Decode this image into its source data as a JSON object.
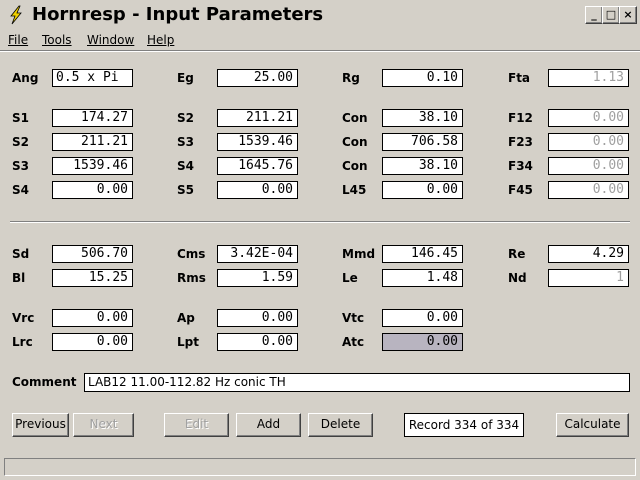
{
  "window": {
    "title": "Hornresp - Input Parameters",
    "minimize_glyph": "_",
    "maximize_glyph": "□",
    "close_glyph": "×"
  },
  "menu": {
    "file": "File",
    "tools": "Tools",
    "window": "Window",
    "help": "Help"
  },
  "params": {
    "ang": {
      "label": "Ang",
      "value": "0.5 x Pi"
    },
    "eg": {
      "label": "Eg",
      "value": "25.00"
    },
    "rg": {
      "label": "Rg",
      "value": "0.10"
    },
    "fta": {
      "label": "Fta",
      "value": "1.13"
    },
    "s1": {
      "label": "S1",
      "value": "174.27"
    },
    "s2a": {
      "label": "S2",
      "value": "211.21"
    },
    "con1": {
      "label": "Con",
      "value": "38.10"
    },
    "f12": {
      "label": "F12",
      "value": "0.00"
    },
    "s2b": {
      "label": "S2",
      "value": "211.21"
    },
    "s3a": {
      "label": "S3",
      "value": "1539.46"
    },
    "con2": {
      "label": "Con",
      "value": "706.58"
    },
    "f23": {
      "label": "F23",
      "value": "0.00"
    },
    "s3b": {
      "label": "S3",
      "value": "1539.46"
    },
    "s4a": {
      "label": "S4",
      "value": "1645.76"
    },
    "con3": {
      "label": "Con",
      "value": "38.10"
    },
    "f34": {
      "label": "F34",
      "value": "0.00"
    },
    "s4b": {
      "label": "S4",
      "value": "0.00"
    },
    "s5": {
      "label": "S5",
      "value": "0.00"
    },
    "l45": {
      "label": "L45",
      "value": "0.00"
    },
    "f45": {
      "label": "F45",
      "value": "0.00"
    },
    "sd": {
      "label": "Sd",
      "value": "506.70"
    },
    "cms": {
      "label": "Cms",
      "value": "3.42E-04"
    },
    "mmd": {
      "label": "Mmd",
      "value": "146.45"
    },
    "re": {
      "label": "Re",
      "value": "4.29"
    },
    "bl": {
      "label": "Bl",
      "value": "15.25"
    },
    "rms": {
      "label": "Rms",
      "value": "1.59"
    },
    "le": {
      "label": "Le",
      "value": "1.48"
    },
    "nd": {
      "label": "Nd",
      "value": "1"
    },
    "vrc": {
      "label": "Vrc",
      "value": "0.00"
    },
    "ap": {
      "label": "Ap",
      "value": "0.00"
    },
    "vtc": {
      "label": "Vtc",
      "value": "0.00"
    },
    "lrc": {
      "label": "Lrc",
      "value": "0.00"
    },
    "lpt": {
      "label": "Lpt",
      "value": "0.00"
    },
    "atc": {
      "label": "Atc",
      "value": "0.00"
    }
  },
  "comment": {
    "label": "Comment",
    "value": "LAB12 11.00-112.82 Hz conic TH"
  },
  "buttons": {
    "previous": "Previous",
    "next": "Next",
    "edit": "Edit",
    "add": "Add",
    "delete": "Delete",
    "calculate": "Calculate"
  },
  "record": "Record 334 of 334",
  "colors": {
    "window_bg": "#d4d0c8",
    "disabled_text": "#a0a0a0",
    "highlight_field": "#b8b4c0"
  }
}
